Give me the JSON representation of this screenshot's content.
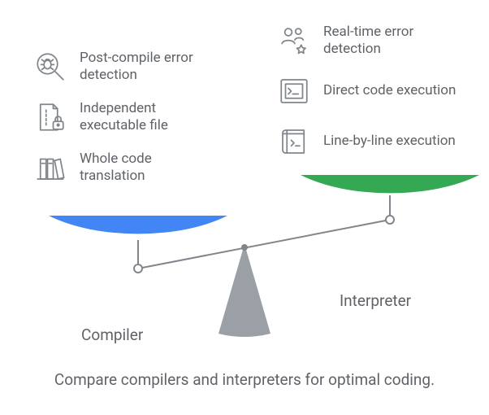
{
  "caption": "Compare compilers and interpreters for optimal coding.",
  "left": {
    "label": "Compiler",
    "items": [
      {
        "label": "Post-compile error detection",
        "icon": "bug-magnifier-icon"
      },
      {
        "label": "Independent executable file",
        "icon": "file-lock-icon"
      },
      {
        "label": "Whole code translation",
        "icon": "books-icon"
      }
    ]
  },
  "right": {
    "label": "Interpreter",
    "items": [
      {
        "label": "Real-time error detection",
        "icon": "people-star-icon"
      },
      {
        "label": "Direct code execution",
        "icon": "terminal-window-icon"
      },
      {
        "label": "Line-by-line execution",
        "icon": "book-terminal-icon"
      }
    ]
  },
  "colors": {
    "left_pan": "#4285F4",
    "right_pan": "#34A853",
    "base": "#9AA0A6",
    "stroke": "#80868B",
    "text": "#5f6368"
  }
}
